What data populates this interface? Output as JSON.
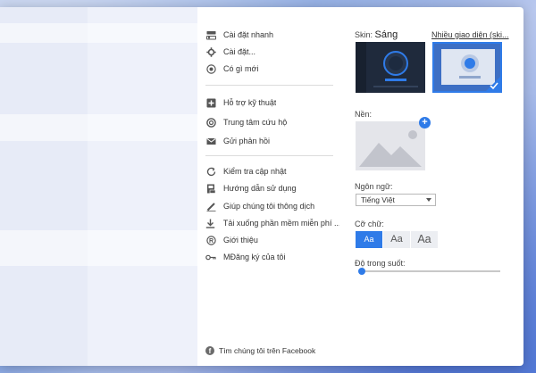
{
  "menu": {
    "group1": [
      {
        "label": "Cài đặt nhanh",
        "icon": "quick-settings-icon"
      },
      {
        "label": "Cài đặt...",
        "icon": "gear-icon"
      },
      {
        "label": "Có gì mới",
        "icon": "whats-new-icon"
      }
    ],
    "group2": [
      {
        "label": "Hỗ trợ kỹ thuật",
        "icon": "support-icon"
      },
      {
        "label": "Trung tâm cứu hộ",
        "icon": "lifebuoy-icon"
      },
      {
        "label": "Gửi phản hồi",
        "icon": "mail-icon"
      }
    ],
    "group3": [
      {
        "label": "Kiểm tra cập nhật",
        "icon": "refresh-icon"
      },
      {
        "label": "Hướng dẫn sử dụng",
        "icon": "guide-icon"
      },
      {
        "label": "Giúp chúng tôi thông dịch",
        "icon": "pencil-icon"
      },
      {
        "label": "Tải xuống phần mềm miễn phí ...",
        "icon": "download-icon"
      },
      {
        "label": "Giới thiệu",
        "icon": "about-icon"
      },
      {
        "label": "MĐăng ký của tôi",
        "icon": "key-icon"
      }
    ],
    "facebook": "Tìm chúng tôi trên Facebook"
  },
  "panel": {
    "skin_prefix": "Skin:",
    "skin_value": "Sáng",
    "more_skins": "Nhiều giao diện (ski...",
    "background_label": "Nền:",
    "language_label": "Ngôn ngữ:",
    "language_value": "Tiếng Việt",
    "font_size_label": "Cỡ chữ:",
    "font_sizes": [
      "Aa",
      "Aa",
      "Aa"
    ],
    "opacity_label": "Độ trong suốt:",
    "opacity_level": 0.02
  },
  "colors": {
    "accent": "#2f7be8"
  }
}
